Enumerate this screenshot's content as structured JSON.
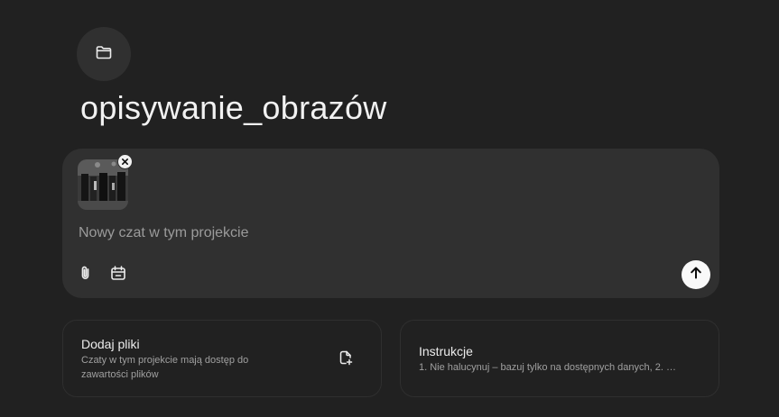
{
  "project": {
    "icon": "folder-icon",
    "title": "opisywanie_obrazów"
  },
  "composer": {
    "attachment_icon": "image-thumbnail",
    "remove_icon": "close-icon",
    "placeholder": "Nowy czat w tym projekcie",
    "value": "",
    "tools": [
      {
        "icon": "paperclip-icon"
      },
      {
        "icon": "calendar-icon"
      }
    ],
    "send_icon": "arrow-up-icon"
  },
  "cards": {
    "files": {
      "title": "Dodaj pliki",
      "description": "Czaty w tym projekcie mają dostęp do zawartości plików",
      "icon": "add-file-icon"
    },
    "instructions": {
      "title": "Instrukcje",
      "description": "1. Nie halucynuj – bazuj tylko na dostępnych danych, 2. …"
    }
  },
  "colors": {
    "background": "#212121",
    "surface": "#303030",
    "send_button": "#f9f9f9"
  }
}
